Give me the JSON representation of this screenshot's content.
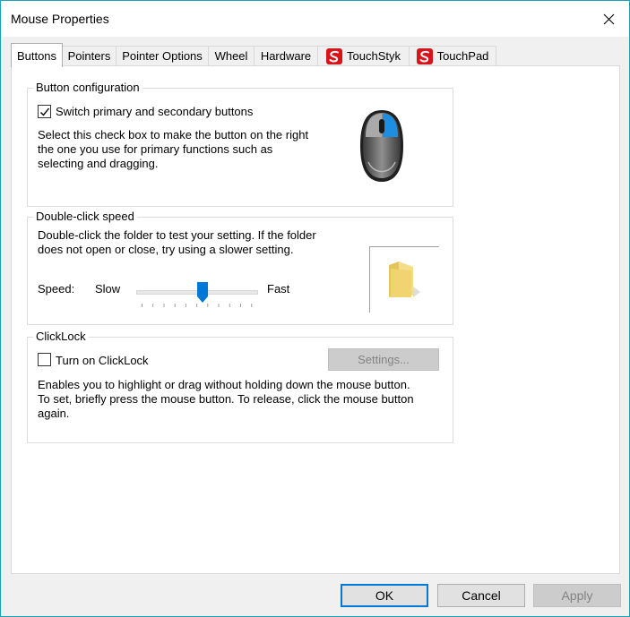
{
  "window": {
    "title": "Mouse Properties"
  },
  "tabs": [
    {
      "label": "Buttons",
      "active": true
    },
    {
      "label": "Pointers",
      "active": false
    },
    {
      "label": "Pointer Options",
      "active": false
    },
    {
      "label": "Wheel",
      "active": false
    },
    {
      "label": "Hardware",
      "active": false
    },
    {
      "label": "TouchStyk",
      "active": false,
      "icon": "synaptics-icon"
    },
    {
      "label": "TouchPad",
      "active": false,
      "icon": "synaptics-icon"
    }
  ],
  "button_config": {
    "group_label": "Button configuration",
    "switch_label": "Switch primary and secondary buttons",
    "switch_checked": true,
    "desc_lines": [
      "Select this check box to make the button on the right",
      "the one you use for primary functions such as",
      "selecting and dragging."
    ]
  },
  "double_click": {
    "group_label": "Double-click speed",
    "desc_lines": [
      "Double-click the folder to test your setting. If the folder",
      "does not open or close, try using a slower setting."
    ],
    "speed_label": "Speed:",
    "slow_label": "Slow",
    "fast_label": "Fast",
    "speed_value": 0.55
  },
  "clicklock": {
    "group_label": "ClickLock",
    "checkbox_label": "Turn on ClickLock",
    "checked": false,
    "settings_label": "Settings...",
    "desc_lines": [
      "Enables you to highlight or drag without holding down the mouse button.",
      "To set, briefly press the mouse button. To release, click the mouse button",
      "again."
    ]
  },
  "footer": {
    "ok": "OK",
    "cancel": "Cancel",
    "apply": "Apply"
  },
  "colors": {
    "accent": "#0078d7",
    "mouse_button_highlight": "#1e8fe0",
    "synaptics_red": "#d7141a"
  }
}
